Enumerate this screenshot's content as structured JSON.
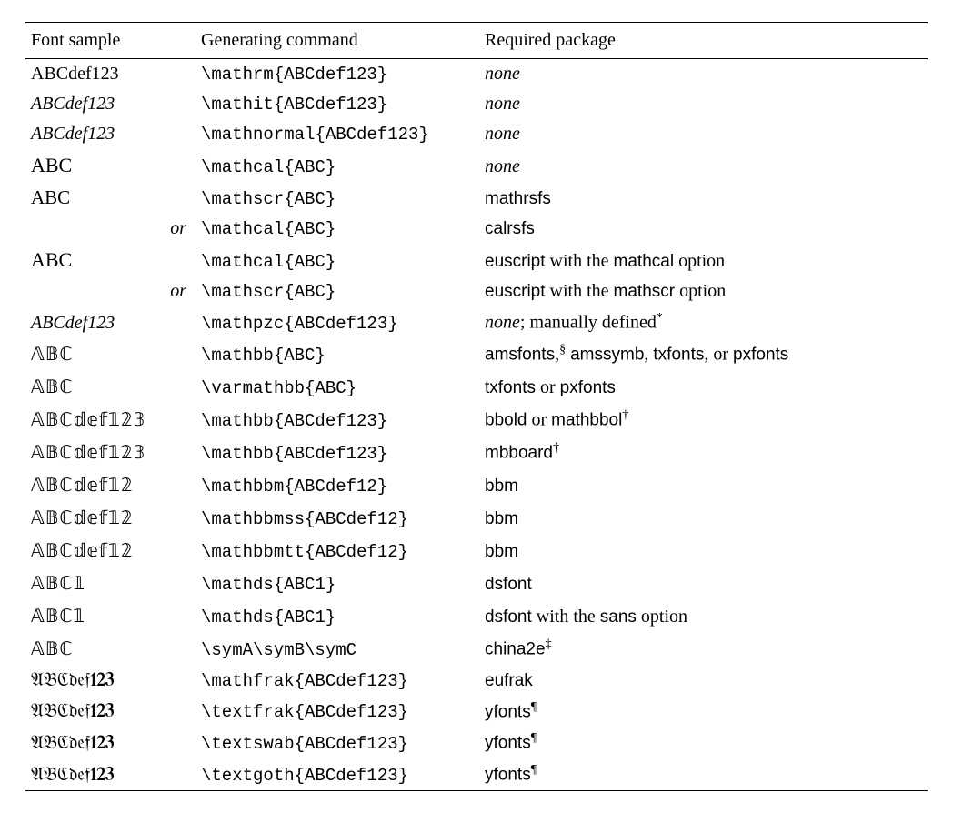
{
  "headers": {
    "sample": "Font sample",
    "command": "Generating command",
    "package": "Required package"
  },
  "or_label": "or",
  "rows": [
    {
      "sample": "ABCdef123",
      "sample_class": "sample-rm",
      "command": "\\mathrm{ABCdef123}",
      "pkg_parts": [
        {
          "t": "none",
          "c": "it"
        }
      ]
    },
    {
      "sample": "ABCdef123",
      "sample_class": "sample-it",
      "command": "\\mathit{ABCdef123}",
      "pkg_parts": [
        {
          "t": "none",
          "c": "it"
        }
      ]
    },
    {
      "sample": "ABCdef123",
      "sample_class": "sample-it",
      "command": "\\mathnormal{ABCdef123}",
      "pkg_parts": [
        {
          "t": "none",
          "c": "it"
        }
      ]
    },
    {
      "sample": "ABC",
      "sample_class": "sample-cal",
      "command": "\\mathcal{ABC}",
      "pkg_parts": [
        {
          "t": "none",
          "c": "it"
        }
      ]
    },
    {
      "sample": "ABC",
      "sample_class": "sample-scr",
      "command": "\\mathscr{ABC}",
      "pkg_parts": [
        {
          "t": "mathrsfs",
          "c": "sf"
        }
      ]
    },
    {
      "is_or": true,
      "command": "\\mathcal{ABC}",
      "pkg_parts": [
        {
          "t": "calrsfs",
          "c": "sf"
        }
      ]
    },
    {
      "sample": "ABC",
      "sample_class": "sample-cal",
      "command": "\\mathcal{ABC}",
      "pkg_parts": [
        {
          "t": "euscript",
          "c": "sf"
        },
        {
          "t": " with the "
        },
        {
          "t": "mathcal",
          "c": "sf"
        },
        {
          "t": " option"
        }
      ]
    },
    {
      "is_or": true,
      "command": "\\mathscr{ABC}",
      "pkg_parts": [
        {
          "t": "euscript",
          "c": "sf"
        },
        {
          "t": " with the "
        },
        {
          "t": "mathscr",
          "c": "sf"
        },
        {
          "t": " option"
        }
      ]
    },
    {
      "sample": "ABCdef123",
      "sample_class": "sample-it",
      "command": "\\mathpzc{ABCdef123}",
      "pkg_parts": [
        {
          "t": "none",
          "c": "it"
        },
        {
          "t": "; manually defined"
        }
      ],
      "sup": "*"
    },
    {
      "sample": "𝔸𝔹ℂ",
      "sample_class": "sample-bb",
      "command": "\\mathbb{ABC}",
      "pkg_parts": [
        {
          "t": "amsfonts",
          "c": "sf"
        },
        {
          "t": ",",
          "sup": "§"
        },
        {
          "t": " "
        },
        {
          "t": "amssymb",
          "c": "sf"
        },
        {
          "t": ", "
        },
        {
          "t": "txfonts",
          "c": "sf"
        },
        {
          "t": ", or "
        },
        {
          "t": "pxfonts",
          "c": "sf"
        }
      ]
    },
    {
      "sample": "𝔸𝔹ℂ",
      "sample_class": "sample-bb",
      "command": "\\varmathbb{ABC}",
      "pkg_parts": [
        {
          "t": "txfonts",
          "c": "sf"
        },
        {
          "t": " or "
        },
        {
          "t": "pxfonts",
          "c": "sf"
        }
      ]
    },
    {
      "sample": "𝔸𝔹ℂ𝕕𝕖𝕗𝟙𝟚𝟛",
      "sample_class": "sample-bb",
      "command": "\\mathbb{ABCdef123}",
      "pkg_parts": [
        {
          "t": "bbold",
          "c": "sf"
        },
        {
          "t": " or "
        },
        {
          "t": "mathbbol",
          "c": "sf"
        }
      ],
      "sup": "†"
    },
    {
      "sample": "𝔸𝔹ℂ𝕕𝕖𝕗𝟙𝟚𝟛",
      "sample_class": "sample-bb",
      "command": "\\mathbb{ABCdef123}",
      "pkg_parts": [
        {
          "t": "mbboard",
          "c": "sf"
        }
      ],
      "sup": "†"
    },
    {
      "sample": "𝔸𝔹ℂ𝕕𝕖𝕗𝟙𝟚",
      "sample_class": "sample-bb",
      "command": "\\mathbbm{ABCdef12}",
      "pkg_parts": [
        {
          "t": "bbm",
          "c": "sf"
        }
      ]
    },
    {
      "sample": "𝔸𝔹ℂ𝕕𝕖𝕗𝟙𝟚",
      "sample_class": "sample-bb",
      "command": "\\mathbbmss{ABCdef12}",
      "pkg_parts": [
        {
          "t": "bbm",
          "c": "sf"
        }
      ]
    },
    {
      "sample": "𝔸𝔹ℂ𝕕𝕖𝕗𝟙𝟚",
      "sample_class": "sample-bb",
      "command": "\\mathbbmtt{ABCdef12}",
      "pkg_parts": [
        {
          "t": "bbm",
          "c": "sf"
        }
      ]
    },
    {
      "sample": "𝔸𝔹ℂ𝟙",
      "sample_class": "sample-bb",
      "command": "\\mathds{ABC1}",
      "pkg_parts": [
        {
          "t": "dsfont",
          "c": "sf"
        }
      ]
    },
    {
      "sample": "𝔸𝔹ℂ𝟙",
      "sample_class": "sample-bb",
      "command": "\\mathds{ABC1}",
      "pkg_parts": [
        {
          "t": "dsfont",
          "c": "sf"
        },
        {
          "t": " with the "
        },
        {
          "t": "sans",
          "c": "sf"
        },
        {
          "t": " option"
        }
      ]
    },
    {
      "sample": "𝔸𝔹ℂ",
      "sample_class": "sample-bb",
      "command": "\\symA\\symB\\symC",
      "pkg_parts": [
        {
          "t": "china2e",
          "c": "sf"
        }
      ],
      "sup": "‡"
    },
    {
      "sample": "𝔄𝔅ℭ𝔡𝔢𝔣123",
      "sample_class": "sample-frak",
      "command": "\\mathfrak{ABCdef123}",
      "pkg_parts": [
        {
          "t": "eufrak",
          "c": "sf"
        }
      ]
    },
    {
      "sample": "𝔄𝔅ℭ𝔡𝔢𝔣123",
      "sample_class": "sample-frak",
      "command": "\\textfrak{ABCdef123}",
      "pkg_parts": [
        {
          "t": "yfonts",
          "c": "sf"
        }
      ],
      "sup": "¶"
    },
    {
      "sample": "𝔄𝔅ℭ𝔡𝔢𝔣123",
      "sample_class": "sample-frak",
      "command": "\\textswab{ABCdef123}",
      "pkg_parts": [
        {
          "t": "yfonts",
          "c": "sf"
        }
      ],
      "sup": "¶"
    },
    {
      "sample": "𝔄𝔅ℭ𝔡𝔢𝔣123",
      "sample_class": "sample-frak",
      "command": "\\textgoth{ABCdef123}",
      "pkg_parts": [
        {
          "t": "yfonts",
          "c": "sf"
        }
      ],
      "sup": "¶"
    }
  ]
}
